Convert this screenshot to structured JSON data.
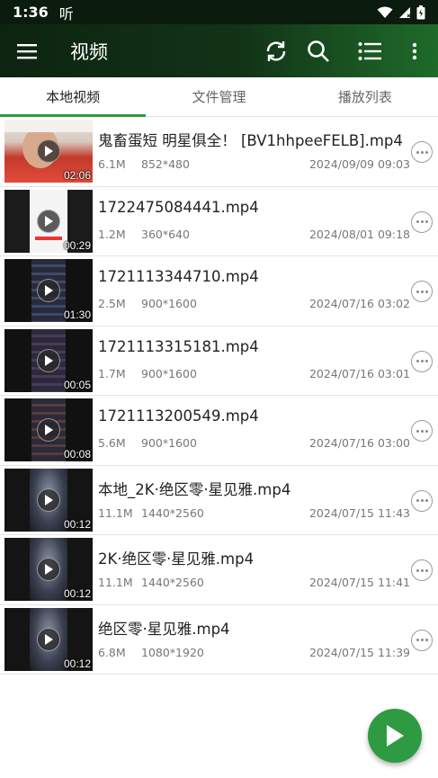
{
  "status_bar": {
    "time": "1:36",
    "app_glyph": "听"
  },
  "app_bar": {
    "title": "视频"
  },
  "tabs": [
    {
      "label": "本地视频",
      "active": true
    },
    {
      "label": "文件管理",
      "active": false
    },
    {
      "label": "播放列表",
      "active": false
    }
  ],
  "videos": [
    {
      "name": "鬼畜蛋短 明星俱全！ [BV1hhpeeFELB].mp4",
      "size": "6.1M",
      "resolution": "852*480",
      "date": "2024/09/09 09:03",
      "duration": "02:06"
    },
    {
      "name": "1722475084441.mp4",
      "size": "1.2M",
      "resolution": "360*640",
      "date": "2024/08/01 09:18",
      "duration": "00:29"
    },
    {
      "name": "1721113344710.mp4",
      "size": "2.5M",
      "resolution": "900*1600",
      "date": "2024/07/16 03:02",
      "duration": "01:30"
    },
    {
      "name": "1721113315181.mp4",
      "size": "1.7M",
      "resolution": "900*1600",
      "date": "2024/07/16 03:01",
      "duration": "00:05"
    },
    {
      "name": "1721113200549.mp4",
      "size": "5.6M",
      "resolution": "900*1600",
      "date": "2024/07/16 03:00",
      "duration": "00:08"
    },
    {
      "name": "本地_2K·绝区零·星见雅.mp4",
      "size": "11.1M",
      "resolution": "1440*2560",
      "date": "2024/07/15 11:43",
      "duration": "00:12"
    },
    {
      "name": "2K·绝区零·星见雅.mp4",
      "size": "11.1M",
      "resolution": "1440*2560",
      "date": "2024/07/15 11:41",
      "duration": "00:12"
    },
    {
      "name": "绝区零·星见雅.mp4",
      "size": "6.8M",
      "resolution": "1080*1920",
      "date": "2024/07/15 11:39",
      "duration": "00:12"
    }
  ],
  "colors": {
    "accent": "#2e9b43",
    "appbar_dark": "#0d2410",
    "appbar_light": "#1f6b2a"
  }
}
